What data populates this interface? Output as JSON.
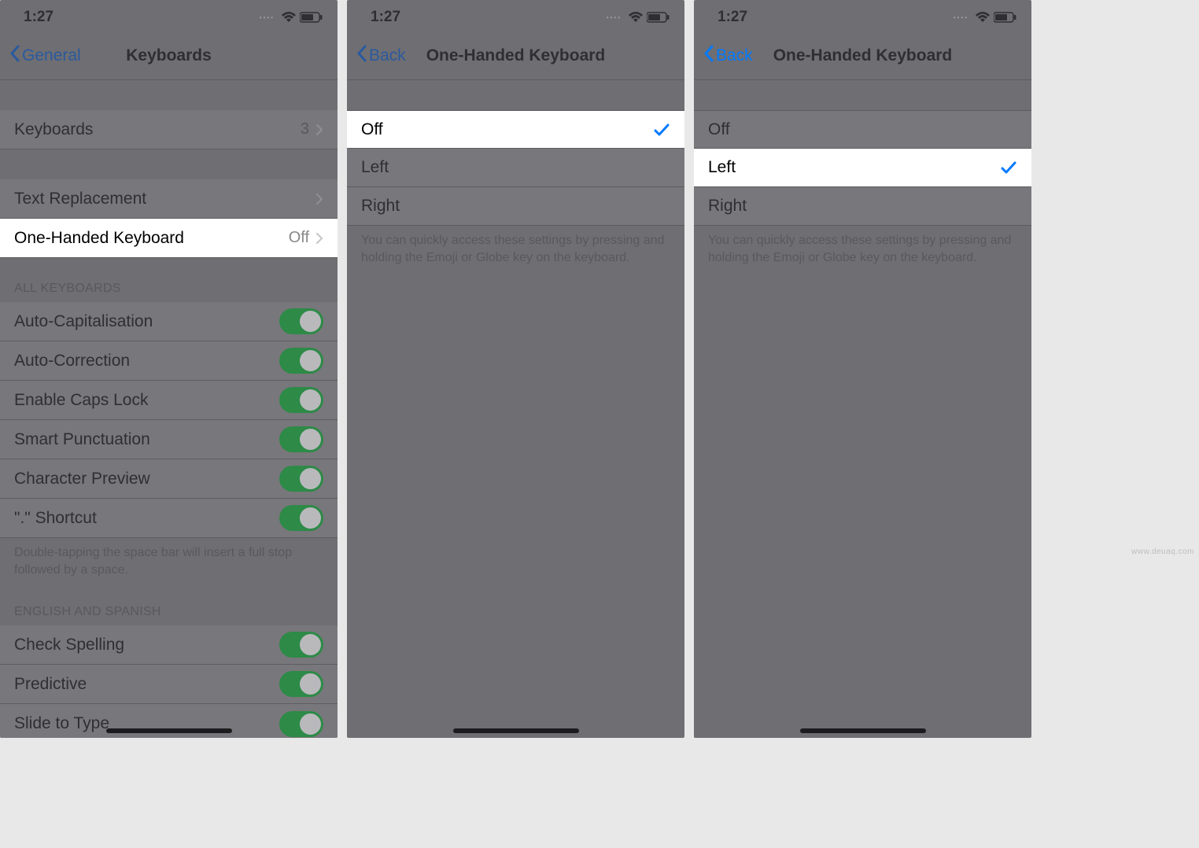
{
  "status": {
    "time": "1:27"
  },
  "watermark": "www.deuaq.com",
  "screen1": {
    "back": "General",
    "title": "Keyboards",
    "rows": {
      "keyboards": {
        "label": "Keyboards",
        "value": "3"
      },
      "textrepl": {
        "label": "Text Replacement"
      },
      "onehand": {
        "label": "One-Handed Keyboard",
        "value": "Off"
      }
    },
    "sections": {
      "all": "ALL KEYBOARDS",
      "english": "ENGLISH AND SPANISH",
      "footer": "Double-tapping the space bar will insert a full stop followed by a space."
    },
    "toggles": {
      "autocap": "Auto-Capitalisation",
      "autocorr": "Auto-Correction",
      "capslock": "Enable Caps Lock",
      "smartpunc": "Smart Punctuation",
      "charprev": "Character Preview",
      "shortcut": "\".\" Shortcut",
      "spell": "Check Spelling",
      "predict": "Predictive",
      "slide": "Slide to Type"
    }
  },
  "screen2": {
    "back": "Back",
    "title": "One-Handed Keyboard",
    "options": {
      "off": "Off",
      "left": "Left",
      "right": "Right"
    },
    "selected": "off",
    "footer": "You can quickly access these settings by pressing and holding the Emoji or Globe key on the keyboard."
  },
  "screen3": {
    "back": "Back",
    "title": "One-Handed Keyboard",
    "options": {
      "off": "Off",
      "left": "Left",
      "right": "Right"
    },
    "selected": "left",
    "footer": "You can quickly access these settings by pressing and holding the Emoji or Globe key on the keyboard."
  }
}
